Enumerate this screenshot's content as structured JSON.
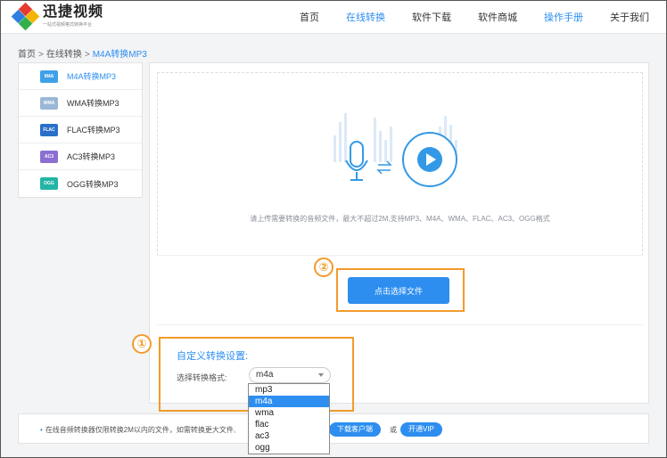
{
  "header": {
    "logo_name": "迅捷视频",
    "logo_slogan": "一站式视频格式转换平台",
    "nav": [
      "首页",
      "在线转换",
      "软件下载",
      "软件商城",
      "操作手册",
      "关于我们"
    ],
    "active_nav": [
      "在线转换",
      "操作手册"
    ]
  },
  "breadcrumb": {
    "home": "首页",
    "section": "在线转换",
    "current": "M4A转换MP3",
    "separator": ">"
  },
  "sidebar": {
    "items": [
      {
        "label": "M4A转换MP3",
        "icon": "M4A",
        "color": "#3fa0e8",
        "active": true
      },
      {
        "label": "WMA转换MP3",
        "icon": "WMA",
        "color": "#9bb7d6",
        "active": false
      },
      {
        "label": "FLAC转换MP3",
        "icon": "FLAC",
        "color": "#2a6fc9",
        "active": false
      },
      {
        "label": "AC3转换MP3",
        "icon": "AC3",
        "color": "#8b6fd1",
        "active": false
      },
      {
        "label": "OGG转换MP3",
        "icon": "OGG",
        "color": "#23b5a4",
        "active": false
      }
    ]
  },
  "upload": {
    "hint": "请上传需要转换的音频文件，最大不超过2M,支持MP3、M4A、WMA、FLAC、AC3、OGG格式",
    "choose_button": "点击选择文件"
  },
  "settings": {
    "title": "自定义转换设置:",
    "format_label": "选择转换格式:",
    "format_value": "m4a",
    "options": [
      "mp3",
      "m4a",
      "wma",
      "flac",
      "ac3",
      "ogg"
    ],
    "selected_option": "m4a"
  },
  "annotations": {
    "step1": "①",
    "step2": "②",
    "color": "#f29b2b"
  },
  "notice": {
    "text": "在线音频转换器仅限转换2M以内的文件，如需转换更大文件,",
    "download_button": "下载客户端",
    "or": "或",
    "vip_button": "开通VIP"
  },
  "colors": {
    "accent": "#2d8ef0",
    "highlight": "#f29b2b"
  }
}
